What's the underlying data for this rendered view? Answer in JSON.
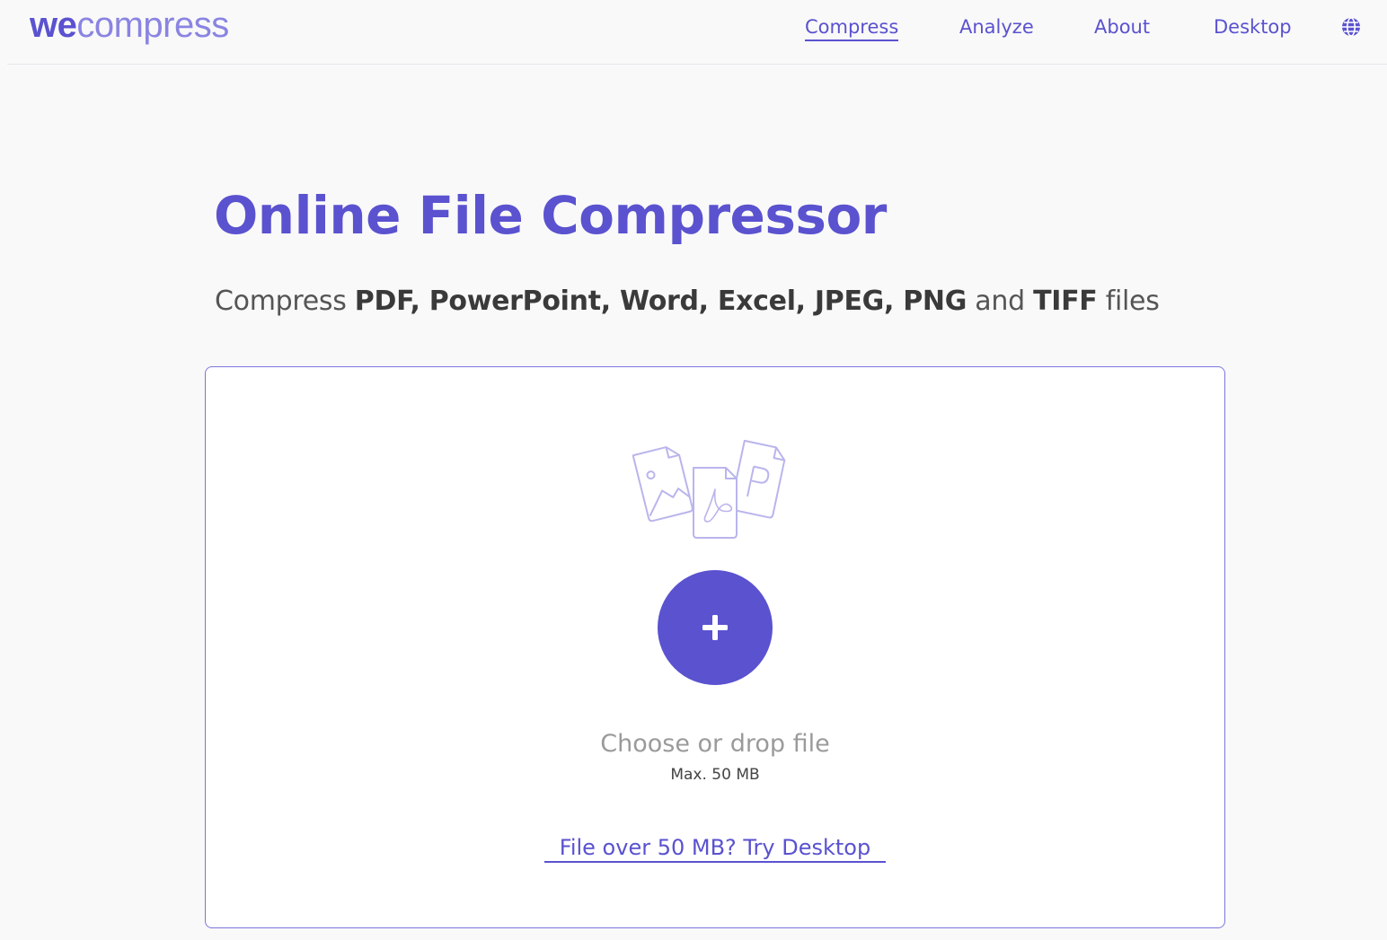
{
  "header": {
    "logo_bold": "we",
    "logo_light": "compress",
    "nav": [
      {
        "label": "Compress",
        "active": true
      },
      {
        "label": "Analyze",
        "active": false
      },
      {
        "label": "About",
        "active": false
      },
      {
        "label": "Desktop",
        "active": false
      }
    ],
    "language_icon": "globe-icon"
  },
  "main": {
    "title": "Online File Compressor",
    "subtitle": {
      "prefix": "Compress ",
      "formats": "PDF, PowerPoint, Word, Excel, JPEG, PNG",
      "and": " and ",
      "last_format": "TIFF",
      "suffix": " files"
    }
  },
  "dropzone": {
    "illustration_icon": "file-types-icon",
    "add_icon": "plus-icon",
    "choose_label": "Choose or drop file",
    "max_label": "Max. 50 MB",
    "desktop_link": "File over 50 MB? Try Desktop"
  },
  "colors": {
    "accent": "#5a52cf",
    "accent_light": "#8a84e2",
    "border": "#7c76dc",
    "background": "#f9f9f9"
  }
}
